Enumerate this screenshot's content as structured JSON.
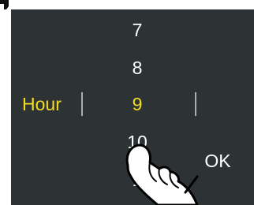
{
  "picker": {
    "label": "Hour",
    "selected_value": "9",
    "values": [
      "7",
      "8",
      "9",
      "10",
      "1"
    ]
  },
  "ok_button": {
    "label": "OK"
  },
  "icons": {
    "gesture": "tap-hand-icon"
  },
  "colors": {
    "screen_background": "#2d3235",
    "selected": "#f6dc1e",
    "text": "#ffffff",
    "divider": "#a9adaf"
  }
}
